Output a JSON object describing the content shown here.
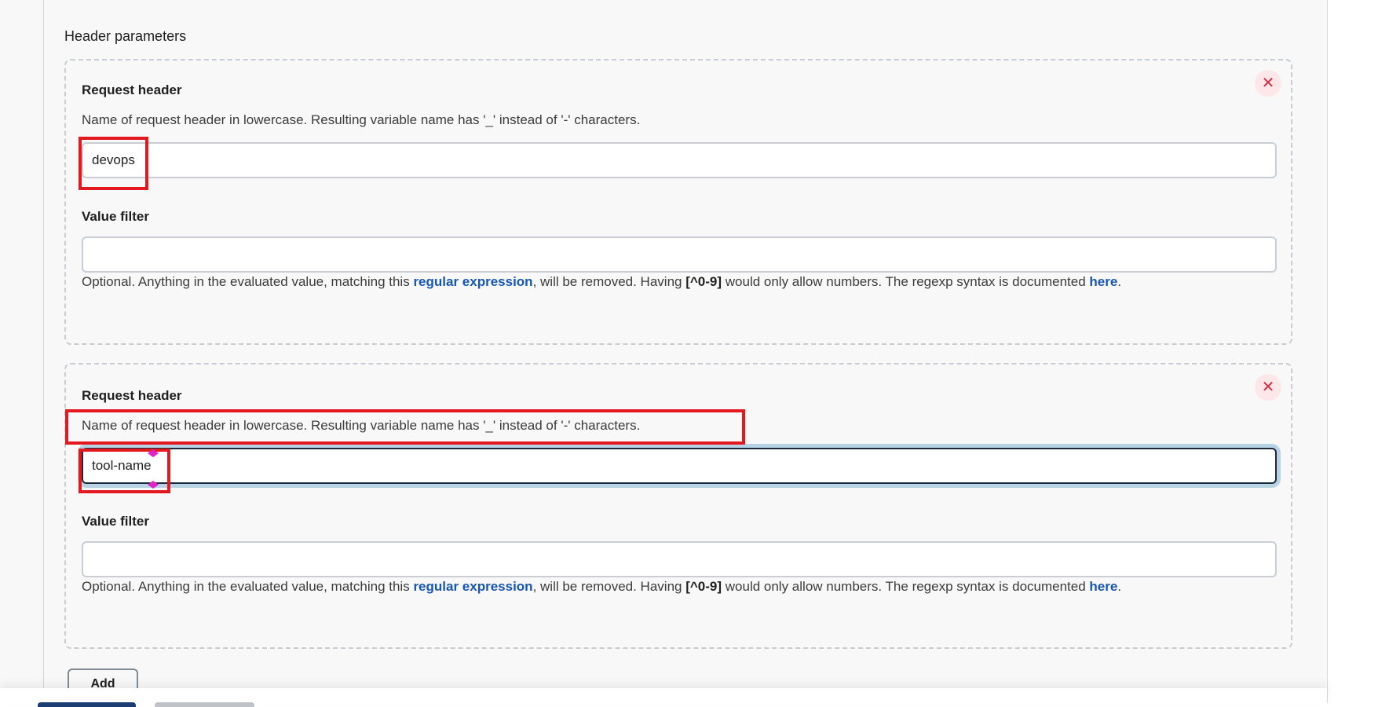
{
  "section": {
    "title": "Header parameters"
  },
  "headers": [
    {
      "request_label": "Request header",
      "request_desc": "Name of request header in lowercase. Resulting variable name has '_' instead of '-' characters.",
      "request_value": "devops",
      "filter_label": "Value filter",
      "filter_value": "",
      "help": {
        "p1": "Optional. Anything in the evaluated value, matching this ",
        "link1": "regular expression",
        "p2": ", will be removed. Having ",
        "code": "[^0-9]",
        "p3": " would only allow numbers. The regexp syntax is documented ",
        "link2": "here",
        "p4": "."
      },
      "remove_icon": "close-icon"
    },
    {
      "request_label": "Request header",
      "request_desc": "Name of request header in lowercase. Resulting variable name has '_' instead of '-' characters.",
      "request_value": "tool-name",
      "filter_label": "Value filter",
      "filter_value": "",
      "help": {
        "p1": "Optional. Anything in the evaluated value, matching this ",
        "link1": "regular expression",
        "p2": ", will be removed. Having ",
        "code": "[^0-9]",
        "p3": " would only allow numbers. The regexp syntax is documented ",
        "link2": "here",
        "p4": "."
      },
      "remove_icon": "close-icon"
    }
  ],
  "buttons": {
    "add": "Add"
  },
  "colors": {
    "highlight": "#e3191f",
    "link": "#1656b5",
    "remove": "#d62d43",
    "focus_ring": "#b9d3e6",
    "primary_button": "#1c3d73"
  }
}
